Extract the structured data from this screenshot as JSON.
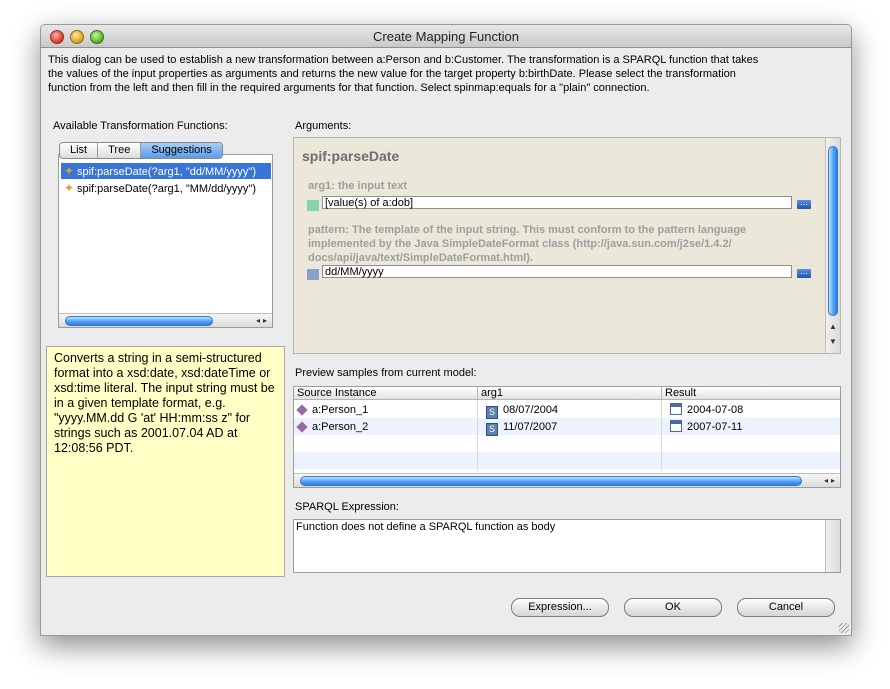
{
  "window": {
    "title": "Create Mapping Function"
  },
  "intro_text": "This dialog can be used to establish a new transformation between a:Person and b:Customer.  The transformation is a SPARQL function that takes\nthe values of the input properties as arguments and returns the new value for the target property b:birthDate.  Please select the transformation\nfunction from the left and then fill in the required arguments for that function.  Select spinmap:equals for a \"plain\" connection.",
  "left": {
    "label": "Available Transformation Functions:",
    "tabs": [
      {
        "label": "List",
        "selected": false
      },
      {
        "label": "Tree",
        "selected": false
      },
      {
        "label": "Suggestions",
        "selected": true
      }
    ],
    "functions": [
      {
        "label": "spif:parseDate(?arg1, \"dd/MM/yyyy\")",
        "selected": true,
        "icon": "function-star-icon"
      },
      {
        "label": "spif:parseDate(?arg1, \"MM/dd/yyyy\")",
        "selected": false,
        "icon": "function-star-icon"
      }
    ],
    "description": "Converts a string in a semi-structured format into a xsd:date, xsd:dateTime or xsd:time literal. The input string must be in a given template format, e.g. \"yyyy.MM.dd G 'at' HH:mm:ss z\" for strings such as 2001.07.04 AD at 12:08:56 PDT."
  },
  "arguments": {
    "label": "Arguments:",
    "function_name": "spif:parseDate",
    "args": [
      {
        "name": "arg1: the input text",
        "value": "[value(s) of a:dob]",
        "color": "#86d3b0"
      },
      {
        "name": "pattern: The template of the input string. This must conform to the pattern language implemented by the Java SimpleDateFormat class (http://java.sun.com/j2se/1.4.2/docs/api/java/text/SimpleDateFormat.html).",
        "name_lines": [
          "pattern: The template of the input string. This must conform to the pattern language",
          "implemented by the Java SimpleDateFormat class (http://java.sun.com/j2se/1.4.2/",
          "docs/api/java/text/SimpleDateFormat.html)."
        ],
        "value": "dd/MM/yyyy",
        "color": "#8a9fc9"
      }
    ],
    "more_button": "..."
  },
  "preview": {
    "label": "Preview samples from current model:",
    "columns": [
      "Source Instance",
      "arg1",
      "Result"
    ],
    "rows": [
      {
        "source": "a:Person_1",
        "arg1": "08/07/2004",
        "result": "2004-07-08"
      },
      {
        "source": "a:Person_2",
        "arg1": "11/07/2007",
        "result": "2007-07-11"
      }
    ]
  },
  "sparql": {
    "label": "SPARQL Expression:",
    "text": "Function does not define a SPARQL function as body"
  },
  "buttons": {
    "expression": "Expression...",
    "ok": "OK",
    "cancel": "Cancel"
  },
  "colors": {
    "selection": "#3875d7",
    "description_bg": "#ffffc6",
    "arguments_bg": "#ebe8d9"
  }
}
